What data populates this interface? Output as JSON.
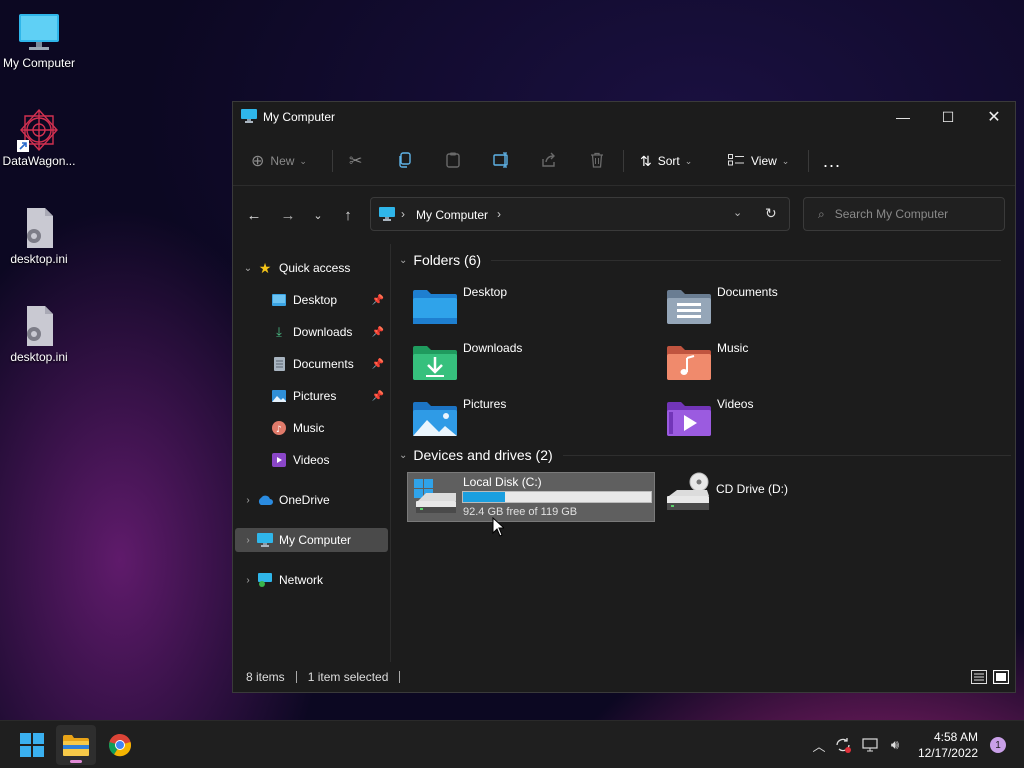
{
  "desktop": {
    "icons": [
      {
        "label": "My Computer",
        "icon": "monitor-icon"
      },
      {
        "label": "DataWagon...",
        "icon": "datawagon-app-icon"
      },
      {
        "label": "desktop.ini",
        "icon": "settings-file-icon"
      },
      {
        "label": "desktop.ini",
        "icon": "settings-file-icon"
      }
    ]
  },
  "window": {
    "title": "My Computer",
    "controls": {
      "minimize": "—",
      "maximize": "☐",
      "close": "✕"
    }
  },
  "toolbar": {
    "new_label": "New",
    "sort_label": "Sort",
    "view_label": "View",
    "more": "..."
  },
  "address": {
    "path": "My Computer",
    "search_placeholder": "Search My Computer"
  },
  "nav": {
    "quick_access": "Quick access",
    "quick_items": [
      {
        "label": "Desktop",
        "pinned": true
      },
      {
        "label": "Downloads",
        "pinned": true
      },
      {
        "label": "Documents",
        "pinned": true
      },
      {
        "label": "Pictures",
        "pinned": true
      },
      {
        "label": "Music",
        "pinned": false
      },
      {
        "label": "Videos",
        "pinned": false
      }
    ],
    "onedrive": "OneDrive",
    "my_computer": "My Computer",
    "network": "Network"
  },
  "content": {
    "folders_header": "Folders (6)",
    "folders": [
      {
        "name": "Desktop"
      },
      {
        "name": "Documents"
      },
      {
        "name": "Downloads"
      },
      {
        "name": "Music"
      },
      {
        "name": "Pictures"
      },
      {
        "name": "Videos"
      }
    ],
    "devices_header": "Devices and drives (2)",
    "drives": [
      {
        "name": "Local Disk (C:)",
        "free_text": "92.4 GB free of 119 GB",
        "used_fraction": 0.224,
        "selected": true
      },
      {
        "name": "CD Drive (D:)"
      }
    ]
  },
  "status": {
    "items": "8 items",
    "selected": "1 item selected"
  },
  "taskbar": {
    "time": "4:58 AM",
    "date": "12/17/2022",
    "notifications": "1"
  },
  "colors": {
    "accent": "#1a9fe0",
    "window_bg": "#1c1c1c",
    "selection": "#4a4a4a"
  }
}
